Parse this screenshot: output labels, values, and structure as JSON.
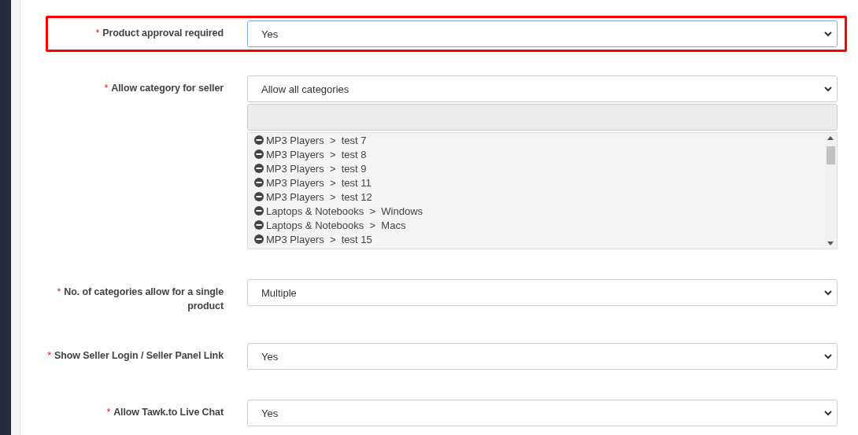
{
  "fields": [
    {
      "label": "Product approval required",
      "required": true,
      "required_mark": "*",
      "value": "Yes",
      "highlighted": true,
      "focused": true
    },
    {
      "label": "Allow category for seller",
      "required": true,
      "required_mark": "*",
      "value": "Allow all categories",
      "highlighted": false,
      "focused": false,
      "category_list": {
        "items": [
          {
            "text": "MP3 Players  >  test 7"
          },
          {
            "text": "MP3 Players  >  test 8"
          },
          {
            "text": "MP3 Players  >  test 9"
          },
          {
            "text": "MP3 Players  >  test 11"
          },
          {
            "text": "MP3 Players  >  test 12"
          },
          {
            "text": "Laptops & Notebooks  >  Windows"
          },
          {
            "text": "Laptops & Notebooks  >  Macs"
          },
          {
            "text": "MP3 Players  >  test 15"
          }
        ]
      }
    },
    {
      "label": "No. of categories allow for a single product",
      "required": true,
      "required_mark": "*",
      "value": "Multiple",
      "highlighted": false,
      "focused": false
    },
    {
      "label": "Show Seller Login / Seller Panel Link",
      "required": true,
      "required_mark": "*",
      "value": "Yes",
      "highlighted": false,
      "focused": false
    },
    {
      "label": "Allow Tawk.to Live Chat",
      "required": true,
      "required_mark": "*",
      "value": "Yes",
      "highlighted": false,
      "focused": false
    }
  ]
}
